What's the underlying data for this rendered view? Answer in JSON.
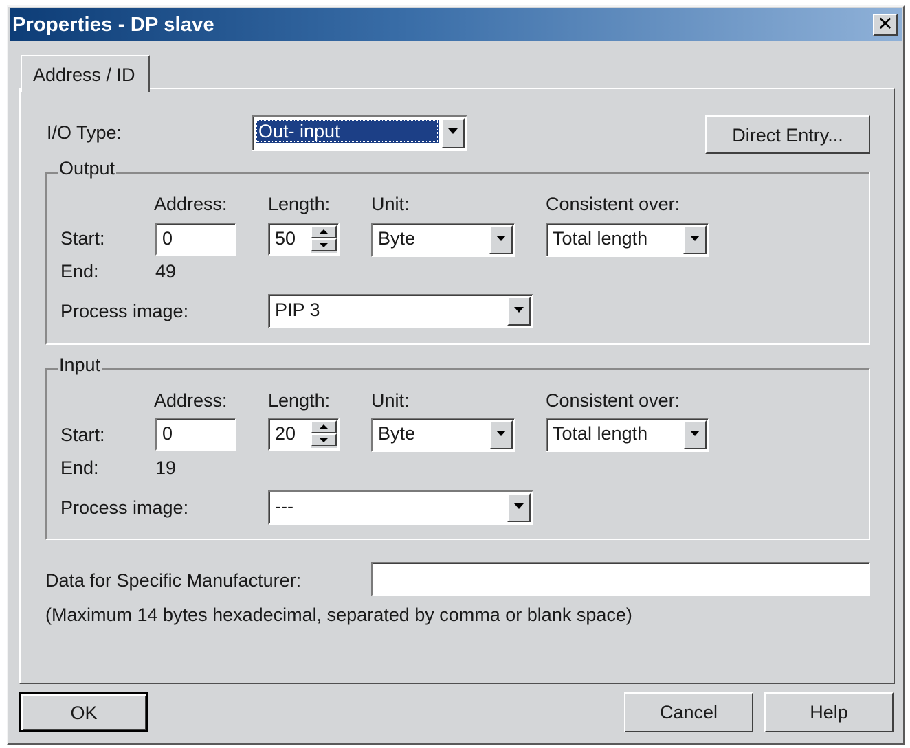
{
  "window": {
    "title": "Properties - DP slave",
    "close_glyph": "✕"
  },
  "tabs": [
    {
      "label": "Address / ID",
      "selected": true
    }
  ],
  "io_type": {
    "label": "I/O Type:",
    "value": "Out- input"
  },
  "direct_entry_button": "Direct Entry...",
  "output": {
    "group_label": "Output",
    "address_header": "Address:",
    "length_header": "Length:",
    "unit_header": "Unit:",
    "consistent_header": "Consistent over:",
    "start_label": "Start:",
    "end_label": "End:",
    "start_address": "0",
    "end_address": "49",
    "length": "50",
    "unit": "Byte",
    "consistent_over": "Total length",
    "process_image_label": "Process image:",
    "process_image": "PIP 3"
  },
  "input": {
    "group_label": "Input",
    "address_header": "Address:",
    "length_header": "Length:",
    "unit_header": "Unit:",
    "consistent_header": "Consistent over:",
    "start_label": "Start:",
    "end_label": "End:",
    "start_address": "0",
    "end_address": "19",
    "length": "20",
    "unit": "Byte",
    "consistent_over": "Total length",
    "process_image_label": "Process image:",
    "process_image": "---"
  },
  "manufacturer": {
    "label": "Data for Specific Manufacturer:",
    "value": "",
    "hint": "(Maximum 14 bytes hexadecimal, separated by comma or blank space)"
  },
  "footer": {
    "ok_label": "OK",
    "cancel_label": "Cancel",
    "help_label": "Help"
  },
  "colors": {
    "titlebar_start": "#0d3d77",
    "titlebar_end": "#8fb1d8",
    "dialog_face": "#d4d6d8",
    "selection": "#1c3f86"
  }
}
